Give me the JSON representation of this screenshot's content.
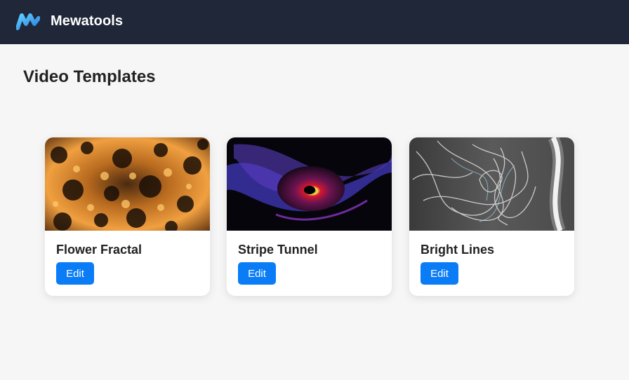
{
  "header": {
    "brand": "Mewatools",
    "logo_icon": "mewatools-logo-icon",
    "background_color": "#1f2738"
  },
  "main": {
    "title": "Video Templates"
  },
  "templates": [
    {
      "name": "Flower Fractal",
      "edit_label": "Edit",
      "thumbnail_icon": "flower-fractal-thumbnail"
    },
    {
      "name": "Stripe Tunnel",
      "edit_label": "Edit",
      "thumbnail_icon": "stripe-tunnel-thumbnail"
    },
    {
      "name": "Bright Lines",
      "edit_label": "Edit",
      "thumbnail_icon": "bright-lines-thumbnail"
    }
  ],
  "colors": {
    "accent": "#0a7cf6",
    "page_background": "#f6f6f6",
    "card_background": "#ffffff"
  }
}
